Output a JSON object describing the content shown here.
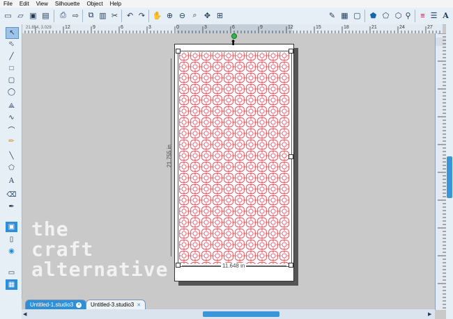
{
  "menu": [
    "File",
    "Edit",
    "View",
    "Silhouette",
    "Object",
    "Help"
  ],
  "ruler": {
    "coords": "21.854, 3.029",
    "ticks": [
      "12",
      "9",
      "6",
      "3",
      "0",
      "3",
      "6",
      "9",
      "12",
      "15",
      "18",
      "21",
      "24",
      "27"
    ]
  },
  "document": {
    "height_label": "21.755 in",
    "width_label": "11.648 in"
  },
  "tabs": [
    {
      "label": "Untitled-1.studio3",
      "active": true
    },
    {
      "label": "Untitled-3.studio3",
      "active": false
    }
  ],
  "watermark": [
    "the",
    "craft",
    "alternative"
  ],
  "colors": {
    "pattern": "#e9676d",
    "accent": "#0a8ad8",
    "selection": "#555555"
  },
  "icons": {
    "toolbar": [
      "new-icon",
      "open-icon",
      "save-icon",
      "save-as-icon",
      "print-icon",
      "send-icon",
      "copy-icon",
      "paste-icon",
      "cut-icon",
      "undo-icon",
      "redo-icon",
      "pan-icon",
      "zoom-in-icon",
      "zoom-out-icon",
      "zoom-box-icon",
      "fit-drag-icon",
      "fit-page-icon"
    ],
    "toolbar_right": [
      "trace-icon",
      "grid-icon",
      "page-setup-icon",
      "fill-color-icon",
      "line-color-icon",
      "shape-icon",
      "replicate-icon",
      "transform-icon",
      "align-icon",
      "lines-icon",
      "text-style-icon"
    ],
    "left": [
      "select-icon",
      "edit-points-icon",
      "line-icon",
      "rectangle-icon",
      "rounded-rect-icon",
      "ellipse-icon",
      "polygon-icon",
      "curve-icon",
      "arc-icon",
      "freehand-icon",
      "smooth-freehand-icon",
      "knife-icon",
      "text-icon",
      "eraser-icon",
      "pen-icon",
      "pixel-icon",
      "library-icon",
      "store-icon",
      "send-panel-icon",
      "settings-panel-icon"
    ]
  }
}
